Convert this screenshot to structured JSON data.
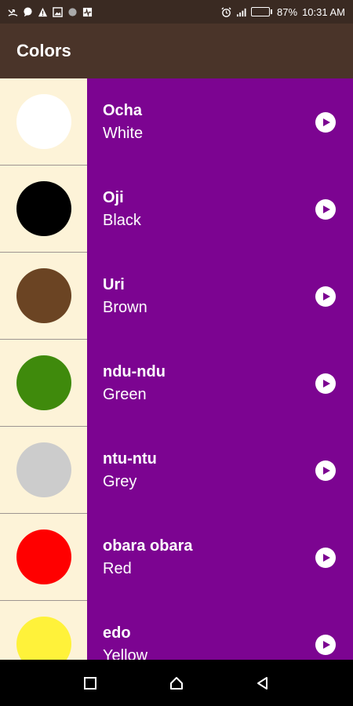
{
  "status_bar": {
    "battery_percent": "87%",
    "time": "10:31 AM",
    "battery_level": 0.87
  },
  "app_bar": {
    "title": "Colors"
  },
  "colors": [
    {
      "word": "Ocha",
      "translation": "White",
      "swatch": "#ffffff"
    },
    {
      "word": "Oji",
      "translation": "Black",
      "swatch": "#000000"
    },
    {
      "word": "Uri",
      "translation": "Brown",
      "swatch": "#6b4423"
    },
    {
      "word": "ndu-ndu",
      "translation": "Green",
      "swatch": "#3f8a0c"
    },
    {
      "word": "ntu-ntu",
      "translation": "Grey",
      "swatch": "#cccccc"
    },
    {
      "word": "obara obara",
      "translation": "Red",
      "swatch": "#ff0000"
    },
    {
      "word": "edo",
      "translation": "Yellow",
      "swatch": "#fff23a"
    }
  ],
  "theme": {
    "app_bar_color": "#4a3429",
    "list_background": "#7c0491",
    "swatch_cell_background": "#fdf3d8"
  },
  "icons": {
    "play": "play-icon",
    "nav_recents": "square-icon",
    "nav_home": "home-icon",
    "nav_back": "triangle-back-icon"
  }
}
